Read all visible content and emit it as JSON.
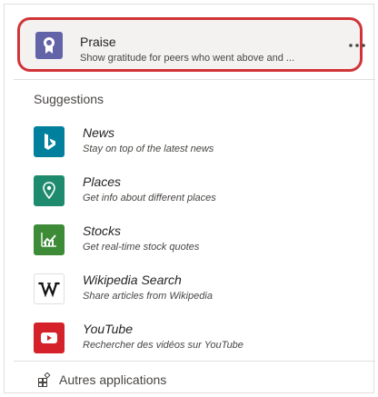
{
  "praise": {
    "title": "Praise",
    "description": "Show gratitude for peers who went above and ...",
    "icon": "badge-icon",
    "icon_color": "#6264a7",
    "more_icon": "more-horizontal-icon"
  },
  "suggestions": {
    "label": "Suggestions",
    "items": [
      {
        "name": "News",
        "description": "Stay on top of the latest news",
        "icon": "bing-logo-icon",
        "color": "#00809d"
      },
      {
        "name": "Places",
        "description": "Get info about different places",
        "icon": "map-pin-icon",
        "color": "#1e8a6e"
      },
      {
        "name": "Stocks",
        "description": "Get real-time stock quotes",
        "icon": "stock-chart-icon",
        "color": "#3d8b37"
      },
      {
        "name": "Wikipedia Search",
        "description": "Share articles from Wikipedia",
        "icon": "wikipedia-logo-icon",
        "color": "#ffffff"
      },
      {
        "name": "YouTube",
        "description": "Rechercher des vidéos sur YouTube",
        "icon": "youtube-logo-icon",
        "color": "#d4212a"
      }
    ]
  },
  "more_apps": {
    "label": "Autres applications",
    "icon": "add-apps-icon"
  },
  "highlight_color": "#d13438"
}
